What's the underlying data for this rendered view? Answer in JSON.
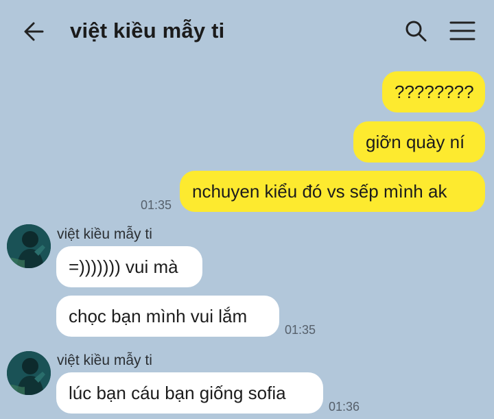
{
  "header": {
    "title": "việt kiều mẫy ti",
    "back_icon": "arrow-left-icon",
    "search_icon": "search-icon",
    "menu_icon": "hamburger-menu-icon"
  },
  "colors": {
    "background": "#b2c7da",
    "outgoing_bubble": "#fdea2f",
    "incoming_bubble": "#ffffff"
  },
  "outgoing": {
    "msg1": "????????",
    "msg2": "giỡn quày ní",
    "msg3": "nchuyen kiểu đó vs sếp mình ak",
    "time": "01:35"
  },
  "group1": {
    "sender": "việt kiều mẫy ti",
    "msg1": "=))))))) vui mà",
    "msg2": "chọc bạn mình vui lắm",
    "time": "01:35"
  },
  "group2": {
    "sender": "việt kiều mẫy ti",
    "msg1": "lúc bạn cáu bạn giống sofia",
    "time": "01:36"
  }
}
